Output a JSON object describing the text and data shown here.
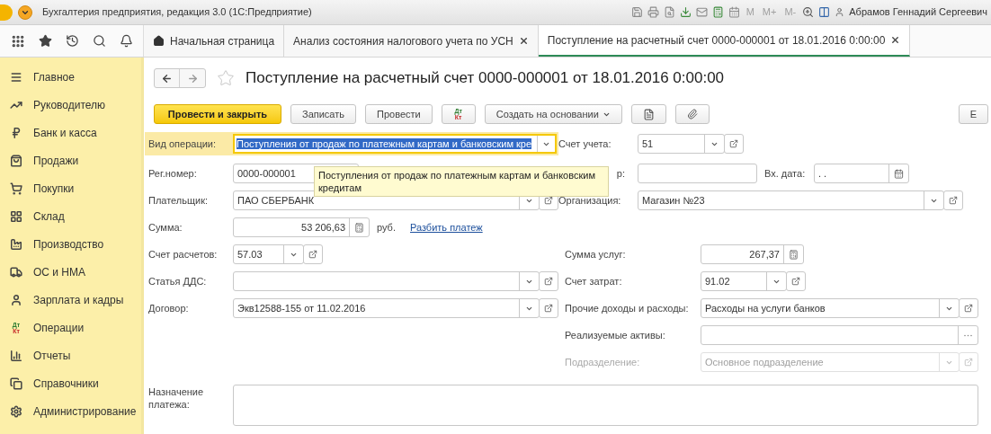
{
  "app_bar": {
    "title": "Бухгалтерия предприятия, редакция 3.0 (1С:Предприятие)",
    "memory_buttons": [
      "M",
      "M+",
      "M-"
    ],
    "user": "Абрамов Геннадий Сергеевич"
  },
  "tabs": [
    {
      "label": "Начальная страница",
      "kind": "home",
      "selected": false
    },
    {
      "label": "Анализ состояния налогового учета по УСН",
      "kind": "closable",
      "selected": false
    },
    {
      "label": "Поступление на расчетный счет 0000-000001 от 18.01.2016 0:00:00",
      "kind": "closable",
      "selected": true
    }
  ],
  "sidebar": {
    "items": [
      {
        "label": "Главное",
        "kind": "menu"
      },
      {
        "label": "Руководителю",
        "kind": "trend"
      },
      {
        "label": "Банк и касса",
        "kind": "ruble"
      },
      {
        "label": "Продажи",
        "kind": "bag"
      },
      {
        "label": "Покупки",
        "kind": "cart"
      },
      {
        "label": "Склад",
        "kind": "grid"
      },
      {
        "label": "Производство",
        "kind": "factory"
      },
      {
        "label": "ОС и НМА",
        "kind": "truck"
      },
      {
        "label": "Зарплата и кадры",
        "kind": "person"
      },
      {
        "label": "Операции",
        "kind": "dtkt",
        "badge": [
          "Дт",
          "Кт"
        ]
      },
      {
        "label": "Отчеты",
        "kind": "bars"
      },
      {
        "label": "Справочники",
        "kind": "books"
      },
      {
        "label": "Администрирование",
        "kind": "gear"
      }
    ]
  },
  "document": {
    "title": "Поступление на расчетный счет 0000-000001 от 18.01.2016 0:00:00",
    "favorite": false,
    "toolbar": [
      {
        "kind": "primary",
        "label": "Провести и закрыть"
      },
      {
        "kind": "button",
        "label": "Записать"
      },
      {
        "kind": "button",
        "label": "Провести"
      },
      {
        "kind": "dtkt",
        "badge": [
          "Дт",
          "Кт"
        ]
      },
      {
        "kind": "dropdown",
        "label": "Создать на основании"
      },
      {
        "kind": "report"
      },
      {
        "kind": "attach"
      },
      {
        "kind": "button",
        "label": "Е"
      }
    ],
    "operation": {
      "label": "Вид операции:",
      "value": "Поступления от продаж по платежным картам и банковским кре",
      "selected": true,
      "focused": true
    },
    "tooltip": "Поступления от продаж по платежным картам и банковским кредитам",
    "left_fields": [
      {
        "label": "Рег.номер:",
        "value": "0000-000001",
        "kind": "text",
        "disabled": false
      },
      {
        "label": "Плательщик:",
        "value": "ПАО СБЕРБАНК",
        "kind": "select",
        "disabled": false
      },
      {
        "label": "Сумма:",
        "value": "53 206,63",
        "kind": "calc",
        "disabled": false,
        "unit": "руб.",
        "link": "Разбить платеж"
      },
      {
        "label": "Счет расчетов:",
        "value": "57.03",
        "kind": "select",
        "disabled": false
      },
      {
        "label": "Статья ДДС:",
        "kind": "select",
        "disabled": false
      },
      {
        "label": "Договор:",
        "value": "Экв12588-155 от 11.02.2016",
        "kind": "select",
        "disabled": false
      }
    ],
    "top_right_fields": [
      {
        "label": "Счет учета:",
        "value": "51",
        "kind": "select",
        "disabled": false
      },
      {
        "label": "р:",
        "kind": "text",
        "disabled": false
      },
      {
        "label": "Организация:",
        "value": "Магазин №23",
        "kind": "select",
        "disabled": false
      }
    ],
    "date_field": {
      "label": "Вх. дата:",
      "value": " .  .",
      "kind": "date",
      "disabled": false
    },
    "right_fields": [
      {
        "label": "Сумма услуг:",
        "value": "267,37",
        "kind": "calc",
        "disabled": false
      },
      {
        "label": "Счет затрат:",
        "value": "91.02",
        "kind": "select",
        "disabled": false
      },
      {
        "label": "Прочие доходы и расходы:",
        "value": "Расходы на услуги банков",
        "kind": "select",
        "disabled": false
      },
      {
        "label": "Реализуемые активы:",
        "kind": "ellipsis",
        "disabled": false
      },
      {
        "label": "Подразделение:",
        "value": "Основное подразделение",
        "kind": "select",
        "disabled": true
      }
    ],
    "purpose": {
      "label": "Назначение платежа:",
      "kind": "textarea"
    }
  }
}
